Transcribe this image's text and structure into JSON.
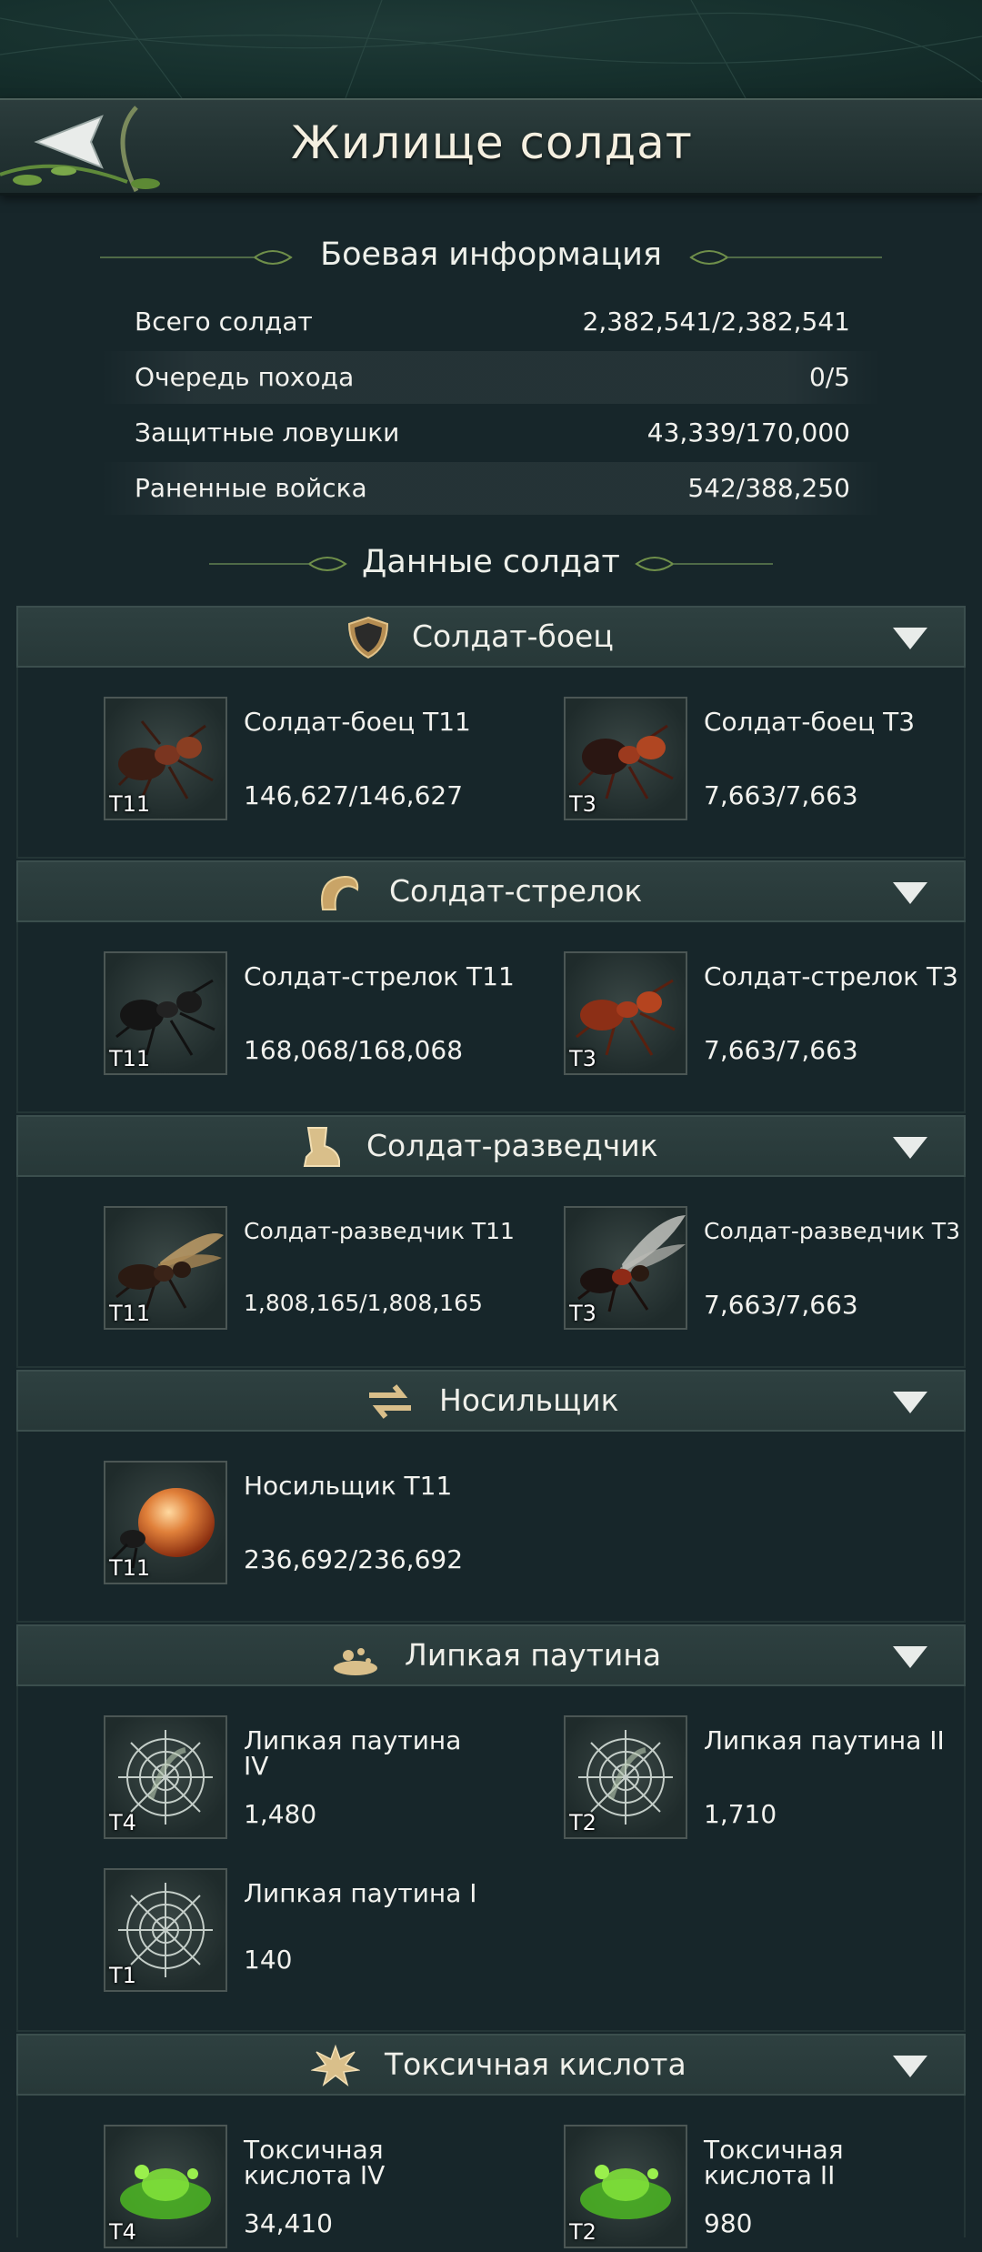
{
  "header": {
    "title": "Жилище солдат"
  },
  "battle_info": {
    "heading": "Боевая информация",
    "rows": [
      {
        "label": "Всего солдат",
        "value": "2,382,541/2,382,541"
      },
      {
        "label": "Очередь похода",
        "value": "0/5"
      },
      {
        "label": "Защитные ловушки",
        "value": "43,339/170,000"
      },
      {
        "label": "Раненные войска",
        "value": "542/388,250"
      }
    ]
  },
  "soldier_data": {
    "heading": "Данные солдат"
  },
  "categories": [
    {
      "title": "Солдат-боец",
      "icon": "shield-icon",
      "units": [
        {
          "name": "Солдат-боец T11",
          "count": "146,627/146,627",
          "tier": "T11",
          "icon": "ant-soldier-image"
        },
        {
          "name": "Солдат-боец T3",
          "count": "7,663/7,663",
          "tier": "T3",
          "icon": "ant-soldier-image"
        }
      ]
    },
    {
      "title": "Солдат-стрелок",
      "icon": "claw-icon",
      "units": [
        {
          "name": "Солдат-стрелок T11",
          "count": "168,068/168,068",
          "tier": "T11",
          "icon": "ant-shooter-image"
        },
        {
          "name": "Солдат-стрелок T3",
          "count": "7,663/7,663",
          "tier": "T3",
          "icon": "ant-shooter-image"
        }
      ]
    },
    {
      "title": "Солдат-разведчик",
      "icon": "boot-icon",
      "units": [
        {
          "name": "Солдат-разведчик T11",
          "count": "1,808,165/1,808,165",
          "tier": "T11",
          "icon": "winged-ant-image"
        },
        {
          "name": "Солдат-разведчик T3",
          "count": "7,663/7,663",
          "tier": "T3",
          "icon": "winged-ant-image"
        }
      ]
    },
    {
      "title": "Носильщик",
      "icon": "transfer-arrows-icon",
      "units": [
        {
          "name": "Носильщик T11",
          "count": "236,692/236,692",
          "tier": "T11",
          "icon": "honeypot-ant-image"
        }
      ]
    },
    {
      "title": "Липкая паутина",
      "icon": "sticky-web-icon",
      "units": [
        {
          "name": "Липкая паутина IV",
          "count": "1,480",
          "tier": "T4",
          "icon": "spider-web-image"
        },
        {
          "name": "Липкая паутина II",
          "count": "1,710",
          "tier": "T2",
          "icon": "spider-web-image"
        },
        {
          "name": "Липкая паутина I",
          "count": "140",
          "tier": "T1",
          "icon": "spider-web-image"
        }
      ]
    },
    {
      "title": "Токсичная кислота",
      "icon": "toxic-splash-icon",
      "units": [
        {
          "name": "Токсичная кислота IV",
          "count": "34,410",
          "tier": "T4",
          "icon": "toxic-acid-image"
        },
        {
          "name": "Токсичная кислота II",
          "count": "980",
          "tier": "T2",
          "icon": "toxic-acid-image"
        }
      ]
    }
  ],
  "colors": {
    "background": "#17262a",
    "header": "#273838",
    "accent_gold": "#c8a96a",
    "ornament_green": "#6f8f4a"
  }
}
